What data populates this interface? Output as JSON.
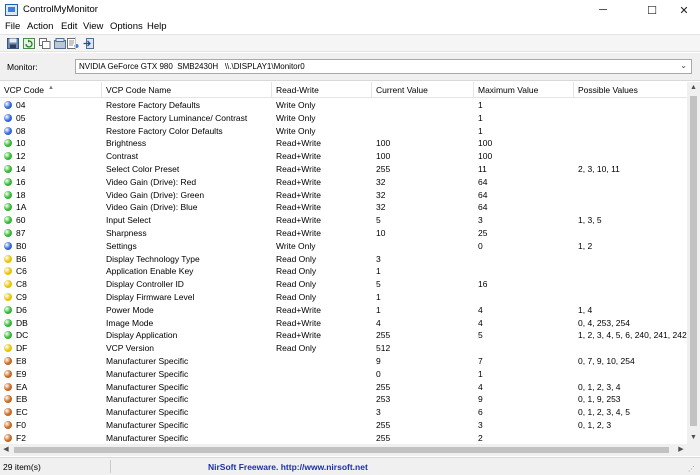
{
  "window": {
    "title": "ControlMyMonitor",
    "minimize_glyph": "─",
    "maximize_glyph": "☐",
    "close_glyph": "✕"
  },
  "menu": [
    "File",
    "Action",
    "Edit",
    "View",
    "Options",
    "Help"
  ],
  "toolbar": {
    "icons": [
      "save-icon",
      "refresh-icon",
      "copy-icon",
      "restore-icon",
      "properties-icon",
      "exit-icon"
    ]
  },
  "monitor": {
    "label": "Monitor:",
    "value": "NVIDIA GeForce GTX 980  SMB2430H   \\\\.\\DISPLAY1\\Monitor0"
  },
  "columns": [
    "VCP Code",
    "VCP Code Name",
    "Read-Write",
    "Current Value",
    "Maximum Value",
    "Possible Values"
  ],
  "sort_indicator": "▲",
  "status_colors": {
    "blue": "#2f64d6",
    "green": "#2eb82e",
    "yellow": "#e6c300",
    "orange": "#c9661a"
  },
  "rows": [
    {
      "status": "blue",
      "code": "04",
      "name": "Restore Factory Defaults",
      "rw": "Write Only",
      "cur": "",
      "max": "1",
      "pos": ""
    },
    {
      "status": "blue",
      "code": "05",
      "name": "Restore Factory Luminance/ Contrast",
      "rw": "Write Only",
      "cur": "",
      "max": "1",
      "pos": ""
    },
    {
      "status": "blue",
      "code": "08",
      "name": "Restore Factory Color Defaults",
      "rw": "Write Only",
      "cur": "",
      "max": "1",
      "pos": ""
    },
    {
      "status": "green",
      "code": "10",
      "name": "Brightness",
      "rw": "Read+Write",
      "cur": "100",
      "max": "100",
      "pos": ""
    },
    {
      "status": "green",
      "code": "12",
      "name": "Contrast",
      "rw": "Read+Write",
      "cur": "100",
      "max": "100",
      "pos": ""
    },
    {
      "status": "green",
      "code": "14",
      "name": "Select Color Preset",
      "rw": "Read+Write",
      "cur": "255",
      "max": "11",
      "pos": "2, 3, 10, 11"
    },
    {
      "status": "green",
      "code": "16",
      "name": "Video Gain (Drive): Red",
      "rw": "Read+Write",
      "cur": "32",
      "max": "64",
      "pos": ""
    },
    {
      "status": "green",
      "code": "18",
      "name": "Video Gain (Drive): Green",
      "rw": "Read+Write",
      "cur": "32",
      "max": "64",
      "pos": ""
    },
    {
      "status": "green",
      "code": "1A",
      "name": "Video Gain (Drive): Blue",
      "rw": "Read+Write",
      "cur": "32",
      "max": "64",
      "pos": ""
    },
    {
      "status": "green",
      "code": "60",
      "name": "Input Select",
      "rw": "Read+Write",
      "cur": "5",
      "max": "3",
      "pos": "1, 3, 5"
    },
    {
      "status": "green",
      "code": "87",
      "name": "Sharpness",
      "rw": "Read+Write",
      "cur": "10",
      "max": "25",
      "pos": ""
    },
    {
      "status": "blue",
      "code": "B0",
      "name": "Settings",
      "rw": "Write Only",
      "cur": "",
      "max": "0",
      "pos": "1, 2"
    },
    {
      "status": "yellow",
      "code": "B6",
      "name": "Display Technology Type",
      "rw": "Read Only",
      "cur": "3",
      "max": "",
      "pos": ""
    },
    {
      "status": "yellow",
      "code": "C6",
      "name": "Application Enable Key",
      "rw": "Read Only",
      "cur": "1",
      "max": "",
      "pos": ""
    },
    {
      "status": "yellow",
      "code": "C8",
      "name": "Display Controller ID",
      "rw": "Read Only",
      "cur": "5",
      "max": "16",
      "pos": ""
    },
    {
      "status": "yellow",
      "code": "C9",
      "name": "Display Firmware Level",
      "rw": "Read Only",
      "cur": "1",
      "max": "",
      "pos": ""
    },
    {
      "status": "green",
      "code": "D6",
      "name": "Power Mode",
      "rw": "Read+Write",
      "cur": "1",
      "max": "4",
      "pos": "1, 4"
    },
    {
      "status": "green",
      "code": "DB",
      "name": "Image Mode",
      "rw": "Read+Write",
      "cur": "4",
      "max": "4",
      "pos": "0, 4, 253, 254"
    },
    {
      "status": "green",
      "code": "DC",
      "name": "Display Application",
      "rw": "Read+Write",
      "cur": "255",
      "max": "5",
      "pos": "1, 2, 3, 4, 5, 6, 240, 241, 242, 249"
    },
    {
      "status": "yellow",
      "code": "DF",
      "name": "VCP Version",
      "rw": "Read Only",
      "cur": "512",
      "max": "",
      "pos": ""
    },
    {
      "status": "orange",
      "code": "E8",
      "name": "Manufacturer Specific",
      "rw": "",
      "cur": "9",
      "max": "7",
      "pos": "0, 7, 9, 10, 254"
    },
    {
      "status": "orange",
      "code": "E9",
      "name": "Manufacturer Specific",
      "rw": "",
      "cur": "0",
      "max": "1",
      "pos": ""
    },
    {
      "status": "orange",
      "code": "EA",
      "name": "Manufacturer Specific",
      "rw": "",
      "cur": "255",
      "max": "4",
      "pos": "0, 1, 2, 3, 4"
    },
    {
      "status": "orange",
      "code": "EB",
      "name": "Manufacturer Specific",
      "rw": "",
      "cur": "253",
      "max": "9",
      "pos": "0, 1, 9, 253"
    },
    {
      "status": "orange",
      "code": "EC",
      "name": "Manufacturer Specific",
      "rw": "",
      "cur": "3",
      "max": "6",
      "pos": "0, 1, 2, 3, 4, 5"
    },
    {
      "status": "orange",
      "code": "F0",
      "name": "Manufacturer Specific",
      "rw": "",
      "cur": "255",
      "max": "3",
      "pos": "0, 1, 2, 3"
    },
    {
      "status": "orange",
      "code": "F2",
      "name": "Manufacturer Specific",
      "rw": "",
      "cur": "255",
      "max": "2",
      "pos": ""
    }
  ],
  "status": {
    "count": "29 item(s)",
    "credit": "NirSoft Freeware.  http://www.nirsoft.net"
  }
}
